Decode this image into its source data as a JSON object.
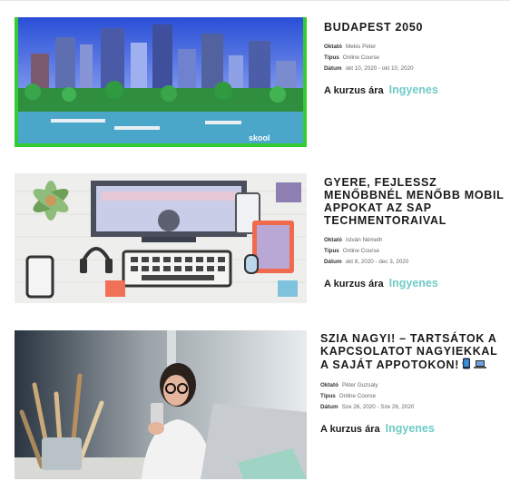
{
  "courses": [
    {
      "title": "BUDAPEST 2050",
      "image_icon": "budapest-city-render-icon",
      "image_badge": "skool",
      "tutor_label": "Oktató",
      "tutor": "Mekis Péter",
      "type_label": "Típus",
      "type": "Online Course",
      "date_label": "Dátum",
      "date": "okt 10, 2020 - okt 10, 2020",
      "price_label": "A kurzus ára",
      "price": "Ingyenes"
    },
    {
      "title": "GYERE, FEJLESSZ MENŐBBNÉL MENŐBB MOBIL APPOKAT AZ SAP TECHMENTORAIVAL",
      "image_icon": "desk-gadgets-illustration-icon",
      "tutor_label": "Oktató",
      "tutor": "István Németh",
      "type_label": "Típus",
      "type": "Online Course",
      "date_label": "Dátum",
      "date": "okt 8, 2020 - dec 3, 2020",
      "price_label": "A kurzus ára",
      "price": "Ingyenes"
    },
    {
      "title": "SZIA NAGYI! – TARTSÁTOK A KAPCSOLATOT NAGYIEKKAL A SAJÁT APPOTOKON!",
      "title_icons": [
        "mobile-phone-icon",
        "laptop-icon"
      ],
      "image_icon": "woman-with-phone-photo-icon",
      "tutor_label": "Oktató",
      "tutor": "Péter Guzsaly",
      "type_label": "Típus",
      "type": "Online Course",
      "date_label": "Dátum",
      "date": "Sze 26, 2020 - Sze 26, 2020",
      "price_label": "A kurzus ára",
      "price": "Ingyenes"
    }
  ],
  "colors": {
    "price": "#6fcbc6",
    "frame": "#33cc33"
  }
}
